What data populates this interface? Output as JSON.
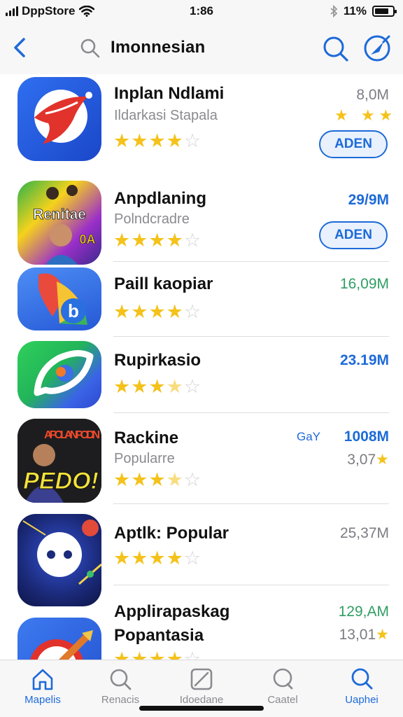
{
  "status_bar": {
    "carrier": "DppStore",
    "time": "1:86",
    "battery": "11%",
    "battery_level": 0.8
  },
  "nav": {
    "title": "Imonnesian",
    "back_icon": "chevron-left-icon",
    "search_icon": "search-icon",
    "compass_icon": "compass-icon"
  },
  "apps": [
    {
      "name": "Inplan Ndlami",
      "subtitle": "Ildarkasi Stapala",
      "rating": 4,
      "size": "8,0M",
      "size_style": "gray",
      "button": "ADEN",
      "mini_stars": "★ ★★"
    },
    {
      "name": "Anpdlaning",
      "subtitle": "Polndcradre",
      "rating": 4,
      "size": "29/9M",
      "size_style": "blue",
      "button": "ADEN",
      "icon_text": "Renitae",
      "icon_text2": "0A"
    },
    {
      "name": "Paill kaopiar",
      "subtitle": "",
      "rating": 4,
      "size": "16,09M",
      "size_style": "green",
      "icon_text": "b"
    },
    {
      "name": "Rupirkasio",
      "subtitle": "",
      "rating": 3.5,
      "size": "23.19M",
      "size_style": "blue"
    },
    {
      "name": "Rackine",
      "subtitle": "Popularre",
      "rating": 3.5,
      "size": "1008M",
      "size_style": "blue",
      "badge": "GaY",
      "extra": "3,07",
      "icon_text": "APOLAN PODIN",
      "icon_text2": "PEDO!"
    },
    {
      "name": "Aptlk: Popular",
      "subtitle": "",
      "rating": 4,
      "size": "25,37M",
      "size_style": "gray"
    },
    {
      "name": "Applirapaskag",
      "subtitle": "Popantasia",
      "rating": 4,
      "size": "129,AM",
      "size_style": "green",
      "extra": "13,01"
    }
  ],
  "tabs": [
    {
      "label": "Mapelis",
      "icon": "home-icon",
      "active": true
    },
    {
      "label": "Renacis",
      "icon": "search-icon",
      "active": false
    },
    {
      "label": "Idoedane",
      "icon": "card-icon",
      "active": false
    },
    {
      "label": "Caatel",
      "icon": "search-icon",
      "active": false
    },
    {
      "label": "Uaphei",
      "icon": "search-icon",
      "active": true
    }
  ],
  "colors": {
    "accent": "#1d6ad8",
    "star": "#f4c21a",
    "bar_bg": "#f7f7f8"
  }
}
